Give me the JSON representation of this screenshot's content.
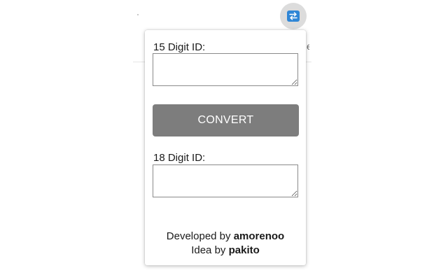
{
  "extension": {
    "icon": "swap-arrows-icon",
    "icon_color": "#2f86d6"
  },
  "popup": {
    "input_label": "15 Digit ID:",
    "input_value": "",
    "convert_label": "CONVERT",
    "output_label": "18 Digit ID:",
    "output_value": "",
    "button_color": "#7d7d7d"
  },
  "footer": {
    "developed_prefix": "Developed by",
    "developer": "amorenoo",
    "idea_prefix": "Idea by",
    "idea_author": "pakito"
  }
}
